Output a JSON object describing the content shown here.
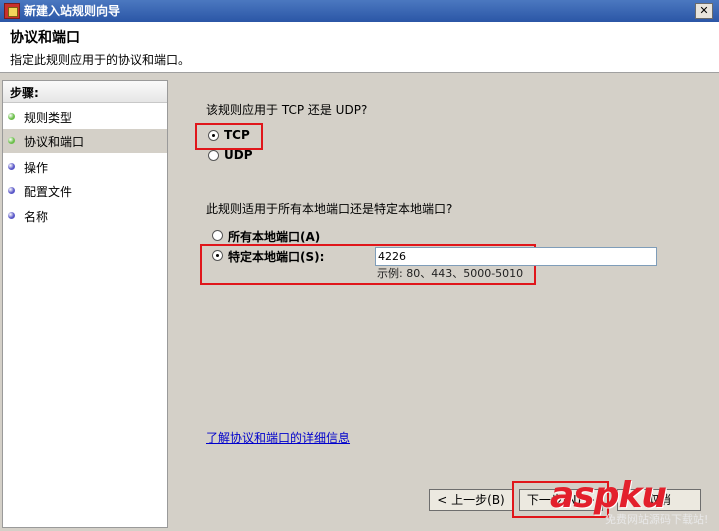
{
  "window": {
    "title": "新建入站规则向导",
    "close_label": "✕"
  },
  "header": {
    "title": "协议和端口",
    "subtitle": "指定此规则应用于的协议和端口。"
  },
  "steps": {
    "heading": "步骤:",
    "items": [
      {
        "label": "规则类型",
        "color": "#6bbf4a"
      },
      {
        "label": "协议和端口",
        "color": "#6bbf4a"
      },
      {
        "label": "操作",
        "color": "#5a58c8"
      },
      {
        "label": "配置文件",
        "color": "#5a58c8"
      },
      {
        "label": "名称",
        "color": "#5a58c8"
      }
    ],
    "active_index": 1
  },
  "protocol": {
    "question": "该规则应用于 TCP 还是 UDP?",
    "options": [
      {
        "label": "TCP",
        "checked": true
      },
      {
        "label": "UDP",
        "checked": false
      }
    ]
  },
  "ports": {
    "question": "此规则适用于所有本地端口还是特定本地端口?",
    "options": [
      {
        "label": "所有本地端口(A)",
        "checked": false
      },
      {
        "label": "特定本地端口(S):",
        "checked": true
      }
    ],
    "value": "4226",
    "example": "示例: 80、443、5000-5010"
  },
  "learn_more": "了解协议和端口的详细信息",
  "buttons": {
    "back": "< 上一步(B)",
    "next": "下一步(N) >",
    "cancel": "取消"
  },
  "watermark": {
    "logo": "aspku",
    "sub": "免费网站源码下载站!"
  }
}
